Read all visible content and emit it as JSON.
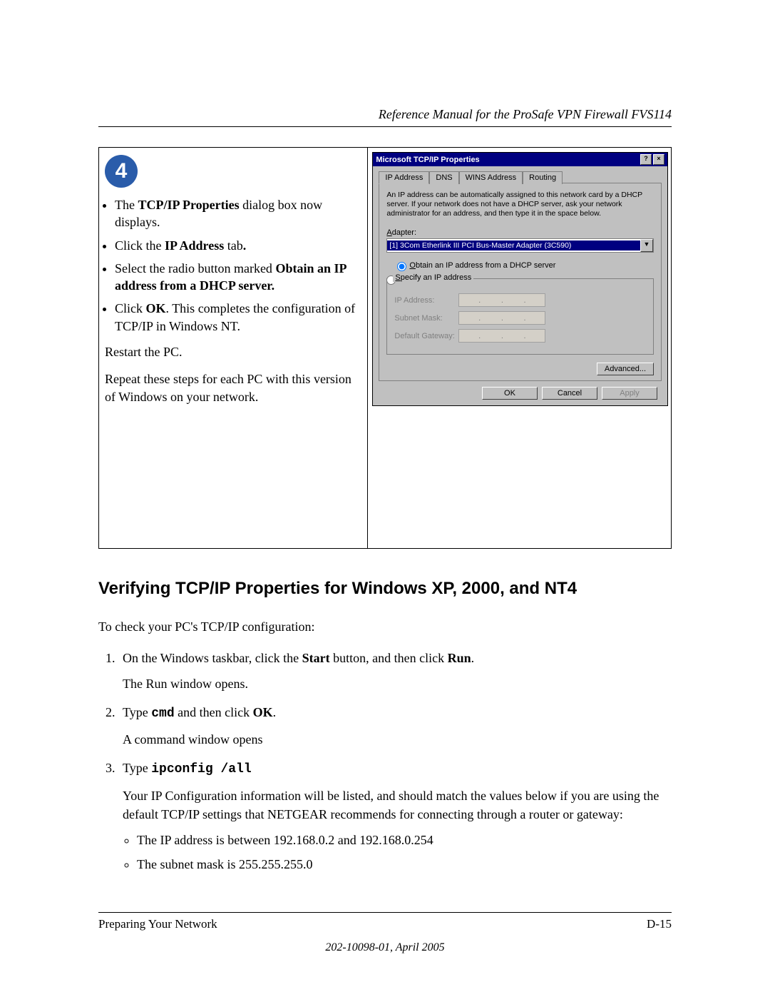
{
  "header": {
    "manual_title": "Reference Manual for the ProSafe VPN Firewall FVS114"
  },
  "step": {
    "number": "4",
    "bullet1_pre": "The ",
    "bullet1_bold": "TCP/IP Properties",
    "bullet1_post": " dialog box now displays.",
    "bullet2_pre": "Click the ",
    "bullet2_bold": "IP Address",
    "bullet2_post": " tab",
    "bullet2_period": ".",
    "bullet3_pre": "Select the radio button marked ",
    "bullet3_bold": "Obtain an IP address from a DHCP server.",
    "bullet4_pre": "Click ",
    "bullet4_bold": "OK",
    "bullet4_post": ".  This completes the configuration of TCP/IP in Windows NT.",
    "restart": "Restart the PC.",
    "repeat": "Repeat these steps for each PC with this version of Windows on your network."
  },
  "dialog": {
    "title": "Microsoft TCP/IP Properties",
    "tabs": {
      "ip": "IP Address",
      "dns": "DNS",
      "wins": "WINS Address",
      "routing": "Routing"
    },
    "description": "An IP address can be automatically assigned to this network card by a DHCP server. If your network does not have a DHCP server, ask your network administrator for an address, and then type it in the space below.",
    "adapter_label": "Adapter:",
    "adapter_value": "[1] 3Com Etherlink III PCI Bus-Master Adapter (3C590)",
    "radio_obtain": "Obtain an IP address from a DHCP server",
    "radio_specify": "Specify an IP address",
    "field_ip": "IP Address:",
    "field_subnet": "Subnet Mask:",
    "field_gateway": "Default Gateway:",
    "btn_advanced": "Advanced...",
    "btn_ok": "OK",
    "btn_cancel": "Cancel",
    "btn_apply": "Apply"
  },
  "body": {
    "heading": "Verifying TCP/IP Properties for Windows XP, 2000, and NT4",
    "intro": "To check your PC's TCP/IP configuration:",
    "step1_pre": "On the Windows taskbar, click the ",
    "step1_b1": "Start",
    "step1_mid": " button, and then click ",
    "step1_b2": "Run",
    "step1_post": ".",
    "step1_line2": "The Run window opens.",
    "step2_pre": "Type ",
    "step2_cmd": "cmd",
    "step2_mid": " and then click ",
    "step2_b": "OK",
    "step2_post": ".",
    "step2_line2": "A command window opens",
    "step3_pre": "Type ",
    "step3_cmd": "ipconfig /all",
    "step3_para": "Your IP Configuration information will be listed, and should match the values below if you are using the default TCP/IP settings that NETGEAR recommends for connecting through a router or gateway:",
    "step3_b1": "The IP address is between 192.168.0.2 and 192.168.0.254",
    "step3_b2": "The subnet mask is 255.255.255.0"
  },
  "footer": {
    "left": "Preparing Your Network",
    "right": "D-15",
    "date": "202-10098-01, April 2005"
  }
}
